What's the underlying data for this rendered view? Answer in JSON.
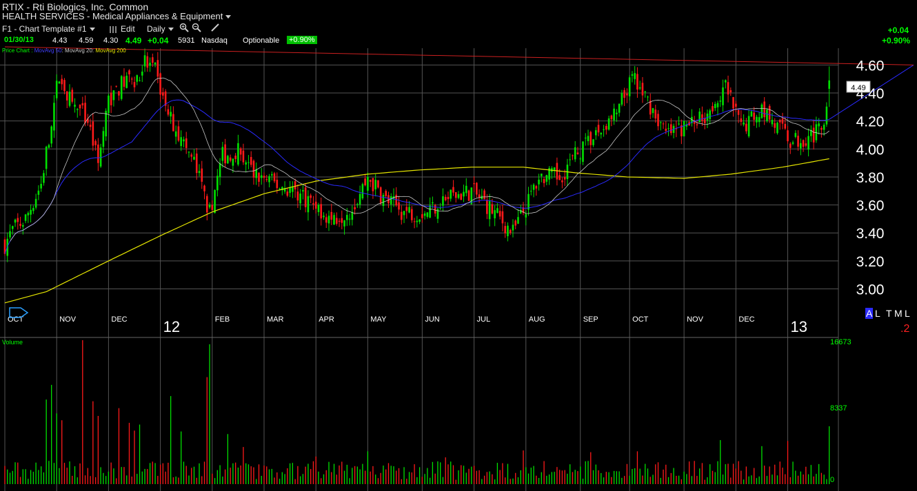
{
  "header": {
    "symbol_line": "RTIX - Rti Biologics, Inc. Common",
    "industry": "HEALTH SERVICES - Medical Appliances & Equipment"
  },
  "toolbar": {
    "template": "F1 - Chart Template #1",
    "edit": "Edit",
    "interval": "Daily"
  },
  "quote": {
    "date": "01/30/13",
    "open": "4.43",
    "high": "4.59",
    "low": "4.30",
    "last": "4.49",
    "change": "+0.04",
    "volume": "5931",
    "exchange": "Nasdaq",
    "optionable": "Optionable",
    "pct": "+0.90%",
    "right_change": "+0.04",
    "right_pct": "+0.90%"
  },
  "legend": {
    "price_chart": "Price Chart :",
    "ma50": "MovAvg 50",
    "ma20": "MovAvg 20",
    "ma200": "MovAvg 200"
  },
  "controls": {
    "a": "A",
    "l": "L",
    "t": "T",
    "m": "M",
    "l2": "L",
    "corner": ".2"
  },
  "colors": {
    "up": "#00e000",
    "down": "#ff1a1a",
    "ma20": "#c8c8c8",
    "ma50": "#2a2aff",
    "ma200": "#e6e600",
    "trend": "#cc2020",
    "grid": "#555555"
  },
  "chart_data": {
    "type": "candlestick",
    "price_axis": {
      "ticks": [
        "4.60",
        "4.40",
        "4.20",
        "4.00",
        "3.80",
        "3.60",
        "3.40",
        "3.20",
        "3.00"
      ],
      "ylim": [
        2.85,
        4.72
      ]
    },
    "last_price_label": "4.49",
    "months": [
      {
        "label": "OCT",
        "day": 0
      },
      {
        "label": "NOV",
        "day": 20
      },
      {
        "label": "DEC",
        "day": 40
      },
      {
        "label": "FEB",
        "day": 80
      },
      {
        "label": "MAR",
        "day": 100
      },
      {
        "label": "APR",
        "day": 120
      },
      {
        "label": "MAY",
        "day": 140
      },
      {
        "label": "JUN",
        "day": 161
      },
      {
        "label": "JUL",
        "day": 181
      },
      {
        "label": "AUG",
        "day": 201
      },
      {
        "label": "SEP",
        "day": 222
      },
      {
        "label": "OCT",
        "day": 241
      },
      {
        "label": "NOV",
        "day": 262
      },
      {
        "label": "DEC",
        "day": 282
      }
    ],
    "years": [
      {
        "label": "12",
        "day": 60
      },
      {
        "label": "13",
        "day": 302
      }
    ],
    "price_anchors": [
      [
        0,
        3.32
      ],
      [
        3,
        3.42
      ],
      [
        8,
        3.5
      ],
      [
        14,
        3.75
      ],
      [
        18,
        4.2
      ],
      [
        21,
        4.55
      ],
      [
        25,
        4.35
      ],
      [
        32,
        4.2
      ],
      [
        36,
        3.9
      ],
      [
        40,
        4.35
      ],
      [
        46,
        4.48
      ],
      [
        50,
        4.5
      ],
      [
        54,
        4.62
      ],
      [
        58,
        4.55
      ],
      [
        62,
        4.3
      ],
      [
        67,
        4.1
      ],
      [
        73,
        3.9
      ],
      [
        79,
        3.55
      ],
      [
        84,
        3.95
      ],
      [
        90,
        4.0
      ],
      [
        96,
        3.82
      ],
      [
        104,
        3.75
      ],
      [
        112,
        3.7
      ],
      [
        120,
        3.6
      ],
      [
        126,
        3.5
      ],
      [
        134,
        3.58
      ],
      [
        140,
        3.8
      ],
      [
        146,
        3.65
      ],
      [
        154,
        3.55
      ],
      [
        162,
        3.55
      ],
      [
        170,
        3.65
      ],
      [
        180,
        3.7
      ],
      [
        186,
        3.6
      ],
      [
        196,
        3.4
      ],
      [
        200,
        3.55
      ],
      [
        206,
        3.8
      ],
      [
        214,
        3.8
      ],
      [
        220,
        3.95
      ],
      [
        228,
        4.1
      ],
      [
        236,
        4.25
      ],
      [
        242,
        4.5
      ],
      [
        248,
        4.35
      ],
      [
        255,
        4.1
      ],
      [
        262,
        4.15
      ],
      [
        270,
        4.25
      ],
      [
        278,
        4.45
      ],
      [
        284,
        4.15
      ],
      [
        292,
        4.3
      ],
      [
        298,
        4.15
      ],
      [
        304,
        4.05
      ],
      [
        310,
        4.1
      ],
      [
        315,
        4.12
      ],
      [
        318,
        4.49
      ]
    ],
    "ma200_anchors": [
      [
        0,
        2.9
      ],
      [
        16,
        2.98
      ],
      [
        40,
        3.2
      ],
      [
        60,
        3.38
      ],
      [
        80,
        3.55
      ],
      [
        100,
        3.68
      ],
      [
        120,
        3.77
      ],
      [
        140,
        3.82
      ],
      [
        160,
        3.85
      ],
      [
        180,
        3.87
      ],
      [
        200,
        3.87
      ],
      [
        220,
        3.83
      ],
      [
        240,
        3.8
      ],
      [
        262,
        3.79
      ],
      [
        280,
        3.82
      ],
      [
        300,
        3.87
      ],
      [
        318,
        3.93
      ]
    ],
    "trend_line": {
      "start": [
        0,
        4.73
      ],
      "end": [
        350,
        4.6
      ]
    },
    "volume_axis": {
      "ticks": [
        "16673",
        "8337",
        "0"
      ],
      "max": 16673
    },
    "volume_label": "Volume",
    "volume_spikes": [
      [
        16,
        9800
      ],
      [
        18,
        11500
      ],
      [
        20,
        8200
      ],
      [
        22,
        7400
      ],
      [
        30,
        16673
      ],
      [
        34,
        9600
      ],
      [
        36,
        7900
      ],
      [
        44,
        8800
      ],
      [
        48,
        7100
      ],
      [
        50,
        6200
      ],
      [
        52,
        6900
      ],
      [
        64,
        10200
      ],
      [
        68,
        6100
      ],
      [
        78,
        12400
      ],
      [
        79,
        16200
      ],
      [
        86,
        5800
      ],
      [
        92,
        4300
      ],
      [
        120,
        3200
      ],
      [
        140,
        3800
      ],
      [
        170,
        3100
      ],
      [
        200,
        3900
      ],
      [
        226,
        3700
      ],
      [
        244,
        3800
      ],
      [
        276,
        5100
      ],
      [
        292,
        4400
      ],
      [
        302,
        5000
      ],
      [
        318,
        6700
      ]
    ]
  }
}
